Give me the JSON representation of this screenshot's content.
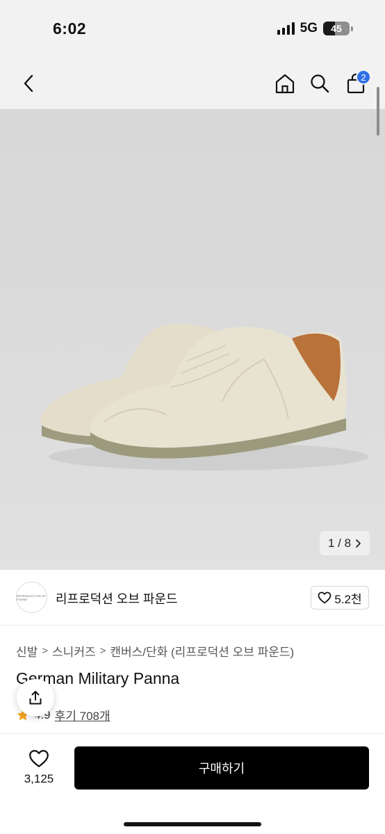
{
  "status": {
    "time": "6:02",
    "network": "5G",
    "battery": "45",
    "battery_level": 0.45
  },
  "nav": {
    "back_icon": "chevron-left-icon",
    "home_icon": "home-icon",
    "search_icon": "search-icon",
    "cart_icon": "shopping-bag-icon",
    "cart_badge": "2"
  },
  "gallery": {
    "counter": "1 / 8",
    "next_icon": "chevron-right-icon"
  },
  "brand": {
    "logo_text": "REPRODUCTION OF FOUND",
    "name": "리프로덕션 오브 파운드",
    "likes": "5.2천"
  },
  "breadcrumb": {
    "items": [
      "신발",
      "스니커즈",
      "캔버스/단화 (리프로덕션 오브 파운드)"
    ],
    "separator": ">"
  },
  "product": {
    "title": "German Military Panna",
    "rating": "4.9",
    "reviews": "후기 708개"
  },
  "bottom": {
    "wish_count": "3,125",
    "buy_label": "구매하기"
  },
  "colors": {
    "badge": "#2f6fe4",
    "buy_button": "#000000",
    "star": "#f6a623"
  }
}
